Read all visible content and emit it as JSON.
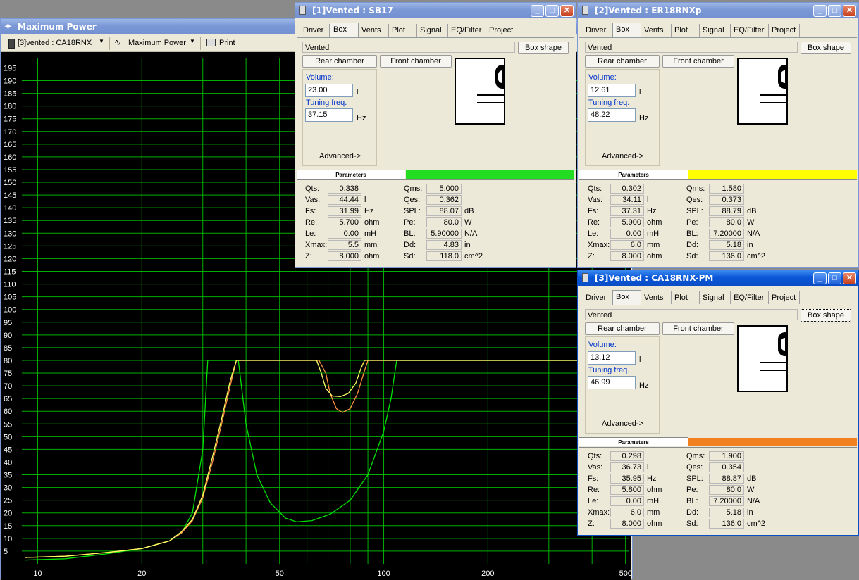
{
  "main_window": {
    "title": "Maximum Power",
    "toolbar": {
      "project_select": "[3]vented : CA18RNX",
      "plot_select": "Maximum Power",
      "print_label": "Print"
    }
  },
  "chart_data": {
    "type": "line",
    "title": "",
    "xlabel": "",
    "ylabel": "",
    "x_scale": "log",
    "xlim": [
      9,
      510
    ],
    "ylim": [
      0,
      199
    ],
    "x_tick_labels": [
      "10",
      "20",
      "50",
      "100",
      "200",
      "500"
    ],
    "x_tick_values": [
      10,
      20,
      50,
      100,
      200,
      500
    ],
    "y_tick_values": [
      5,
      10,
      15,
      20,
      25,
      30,
      35,
      40,
      45,
      50,
      55,
      60,
      65,
      70,
      75,
      80,
      85,
      90,
      95,
      100,
      105,
      110,
      115,
      120,
      125,
      130,
      135,
      140,
      145,
      150,
      155,
      160,
      165,
      170,
      175,
      180,
      185,
      190,
      195
    ],
    "grid": true,
    "background": "#000000",
    "grid_color": "#00b000",
    "series": [
      {
        "color": "#00e000",
        "x": [
          9.2,
          12,
          16,
          20,
          24,
          26,
          28,
          30,
          31,
          33,
          35,
          37,
          38,
          40,
          43,
          47,
          52,
          56,
          62,
          70,
          80,
          90,
          100,
          105,
          109,
          120,
          150,
          200,
          300,
          400,
          510
        ],
        "y": [
          1.5,
          2,
          4,
          6,
          9,
          12,
          20,
          45,
          80,
          80,
          80,
          80,
          80,
          55,
          35,
          24,
          18,
          16.5,
          17,
          19.5,
          25,
          35,
          52,
          65,
          80,
          80,
          80,
          80,
          80,
          80,
          80
        ]
      },
      {
        "color": "#ff9040",
        "x": [
          9.2,
          12,
          16,
          20,
          24,
          26,
          28,
          30,
          32,
          34,
          36,
          37.5,
          38,
          45,
          60,
          65,
          68,
          70,
          73,
          76,
          80,
          84,
          88,
          90,
          95,
          100,
          150,
          200,
          300,
          400,
          510
        ],
        "y": [
          2.5,
          3,
          4.5,
          6,
          9,
          12,
          17,
          26,
          40,
          55,
          70,
          80,
          80,
          80,
          80,
          80,
          75,
          67,
          61,
          59.5,
          61,
          67,
          76,
          80,
          80,
          80,
          80,
          80,
          80,
          80,
          80
        ]
      },
      {
        "color": "#ffff66",
        "x": [
          9.2,
          12,
          16,
          20,
          24,
          26,
          28,
          30,
          32,
          34,
          36,
          37.5,
          38,
          45,
          60,
          64,
          66,
          68,
          71,
          75,
          79,
          83,
          86,
          88,
          95,
          100,
          150,
          200,
          300,
          400,
          510
        ],
        "y": [
          2.5,
          3,
          4.5,
          6,
          9,
          12.5,
          17.5,
          27,
          42,
          57,
          72,
          80,
          80,
          80,
          80,
          80,
          75,
          69,
          66,
          65.8,
          67,
          71,
          77,
          80,
          80,
          80,
          80,
          80,
          80,
          80,
          80
        ]
      }
    ]
  },
  "windows": [
    {
      "title": "[1]Vented : SB17",
      "active": false,
      "tabs": [
        "Driver",
        "Box",
        "Vents",
        "Plot",
        "Signal",
        "EQ/Filter",
        "Project"
      ],
      "box_type": "Vented",
      "box_shape_label": "Box shape",
      "rear_chamber_label": "Rear chamber",
      "front_chamber_label": "Front chamber",
      "volume_label": "Volume:",
      "volume": "23.00",
      "volume_unit": "l",
      "tuning_label": "Tuning freq.",
      "tuning": "37.15",
      "tuning_unit": "Hz",
      "advanced_label": "Advanced->",
      "params_header": "Parameters",
      "color": "#22dd22",
      "params_left": [
        {
          "label": "Qts:",
          "value": "0.338",
          "unit": ""
        },
        {
          "label": "Vas:",
          "value": "44.44",
          "unit": "l"
        },
        {
          "label": "Fs:",
          "value": "31.99",
          "unit": "Hz"
        },
        {
          "label": "Re:",
          "value": "5.700",
          "unit": "ohm"
        },
        {
          "label": "Le:",
          "value": "0.00",
          "unit": "mH"
        },
        {
          "label": "Xmax:",
          "value": "5.5",
          "unit": "mm"
        },
        {
          "label": "Z:",
          "value": "8.000",
          "unit": "ohm"
        }
      ],
      "params_right": [
        {
          "label": "Qms:",
          "value": "5.000",
          "unit": ""
        },
        {
          "label": "Qes:",
          "value": "0.362",
          "unit": ""
        },
        {
          "label": "SPL:",
          "value": "88.07",
          "unit": "dB"
        },
        {
          "label": "Pe:",
          "value": "80.0",
          "unit": "W"
        },
        {
          "label": "BL:",
          "value": "5.90000",
          "unit": "N/A"
        },
        {
          "label": "Dd:",
          "value": "4.83",
          "unit": "in"
        },
        {
          "label": "Sd:",
          "value": "118.0",
          "unit": "cm^2"
        }
      ]
    },
    {
      "title": "[2]Vented : ER18RNXp",
      "active": false,
      "tabs": [
        "Driver",
        "Box",
        "Vents",
        "Plot",
        "Signal",
        "EQ/Filter",
        "Project"
      ],
      "box_type": "Vented",
      "box_shape_label": "Box shape",
      "rear_chamber_label": "Rear chamber",
      "front_chamber_label": "Front chamber",
      "volume_label": "Volume:",
      "volume": "12.61",
      "volume_unit": "l",
      "tuning_label": "Tuning freq.",
      "tuning": "48.22",
      "tuning_unit": "Hz",
      "advanced_label": "Advanced->",
      "params_header": "Parameters",
      "color": "#ffff00",
      "params_left": [
        {
          "label": "Qts:",
          "value": "0.302",
          "unit": ""
        },
        {
          "label": "Vas:",
          "value": "34.11",
          "unit": "l"
        },
        {
          "label": "Fs:",
          "value": "37.31",
          "unit": "Hz"
        },
        {
          "label": "Re:",
          "value": "5.900",
          "unit": "ohm"
        },
        {
          "label": "Le:",
          "value": "0.00",
          "unit": "mH"
        },
        {
          "label": "Xmax:",
          "value": "6.0",
          "unit": "mm"
        },
        {
          "label": "Z:",
          "value": "8.000",
          "unit": "ohm"
        }
      ],
      "params_right": [
        {
          "label": "Qms:",
          "value": "1.580",
          "unit": ""
        },
        {
          "label": "Qes:",
          "value": "0.373",
          "unit": ""
        },
        {
          "label": "SPL:",
          "value": "88.79",
          "unit": "dB"
        },
        {
          "label": "Pe:",
          "value": "80.0",
          "unit": "W"
        },
        {
          "label": "BL:",
          "value": "7.20000",
          "unit": "N/A"
        },
        {
          "label": "Dd:",
          "value": "5.18",
          "unit": "in"
        },
        {
          "label": "Sd:",
          "value": "136.0",
          "unit": "cm^2"
        }
      ]
    },
    {
      "title": "[3]Vented : CA18RNX-PM",
      "active": true,
      "tabs": [
        "Driver",
        "Box",
        "Vents",
        "Plot",
        "Signal",
        "EQ/Filter",
        "Project"
      ],
      "box_type": "Vented",
      "box_shape_label": "Box shape",
      "rear_chamber_label": "Rear chamber",
      "front_chamber_label": "Front chamber",
      "volume_label": "Volume:",
      "volume": "13.12",
      "volume_unit": "l",
      "tuning_label": "Tuning freq.",
      "tuning": "46.99",
      "tuning_unit": "Hz",
      "advanced_label": "Advanced->",
      "params_header": "Parameters",
      "color": "#f08020",
      "params_left": [
        {
          "label": "Qts:",
          "value": "0.298",
          "unit": ""
        },
        {
          "label": "Vas:",
          "value": "36.73",
          "unit": "l"
        },
        {
          "label": "Fs:",
          "value": "35.95",
          "unit": "Hz"
        },
        {
          "label": "Re:",
          "value": "5.800",
          "unit": "ohm"
        },
        {
          "label": "Le:",
          "value": "0.00",
          "unit": "mH"
        },
        {
          "label": "Xmax:",
          "value": "6.0",
          "unit": "mm"
        },
        {
          "label": "Z:",
          "value": "8.000",
          "unit": "ohm"
        }
      ],
      "params_right": [
        {
          "label": "Qms:",
          "value": "1.900",
          "unit": ""
        },
        {
          "label": "Qes:",
          "value": "0.354",
          "unit": ""
        },
        {
          "label": "SPL:",
          "value": "88.87",
          "unit": "dB"
        },
        {
          "label": "Pe:",
          "value": "80.0",
          "unit": "W"
        },
        {
          "label": "BL:",
          "value": "7.20000",
          "unit": "N/A"
        },
        {
          "label": "Dd:",
          "value": "5.18",
          "unit": "in"
        },
        {
          "label": "Sd:",
          "value": "136.0",
          "unit": "cm^2"
        }
      ]
    }
  ]
}
